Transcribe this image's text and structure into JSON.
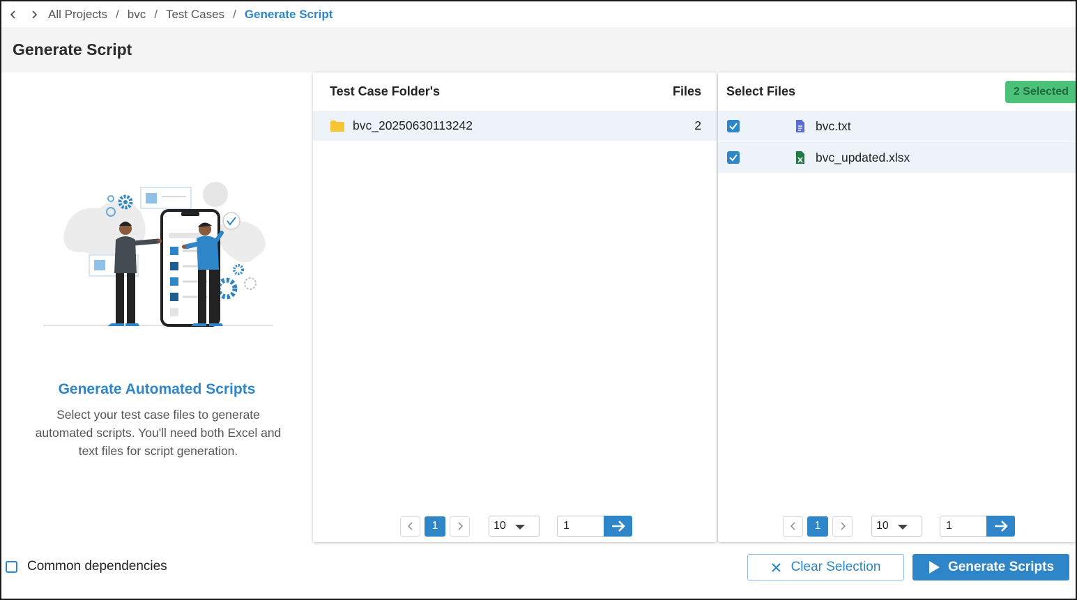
{
  "breadcrumb": {
    "items": [
      "All Projects",
      "bvc",
      "Test Cases"
    ],
    "current": "Generate Script",
    "separator": "/"
  },
  "page": {
    "title": "Generate Script"
  },
  "info": {
    "heading": "Generate Automated Scripts",
    "description": "Select your test case files to generate automated scripts. You'll need both Excel and text files for script generation."
  },
  "folders_panel": {
    "header_name": "Test Case Folder's",
    "header_files": "Files",
    "rows": [
      {
        "name": "bvc_20250630113242",
        "files": "2"
      }
    ],
    "pagination": {
      "current_page": "1",
      "page_size": "10",
      "goto_value": "1"
    }
  },
  "files_panel": {
    "header": "Select Files",
    "selected_badge": "2 Selected",
    "rows": [
      {
        "name": "bvc.txt",
        "type": "text-file-icon",
        "checked": true
      },
      {
        "name": "bvc_updated.xlsx",
        "type": "excel-file-icon",
        "checked": true
      }
    ],
    "pagination": {
      "current_page": "1",
      "page_size": "10",
      "goto_value": "1"
    }
  },
  "footer": {
    "common_dependencies_label": "Common dependencies",
    "clear_button": "Clear Selection",
    "generate_button": "Generate Scripts"
  },
  "colors": {
    "accent": "#2e86c9",
    "badge_bg": "#4cc17a",
    "row_highlight": "#eef3fa",
    "folder_yellow": "#f7c531"
  }
}
